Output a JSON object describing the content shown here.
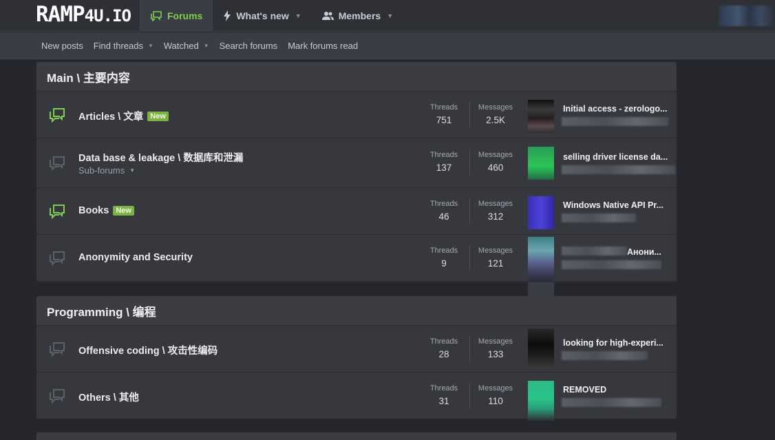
{
  "header": {
    "logo_main": "RAMP",
    "logo_suffix": "4U.IO",
    "nav": [
      {
        "label": "Forums",
        "icon": "chat-bubbles-icon",
        "active": true
      },
      {
        "label": "What's new",
        "icon": "bolt-icon",
        "has_menu": true
      },
      {
        "label": "Members",
        "icon": "users-icon",
        "has_menu": true
      }
    ]
  },
  "subnav": [
    {
      "label": "New posts"
    },
    {
      "label": "Find threads",
      "has_menu": true
    },
    {
      "label": "Watched",
      "has_menu": true
    },
    {
      "label": "Search forums"
    },
    {
      "label": "Mark forums read"
    }
  ],
  "colors": {
    "accent": "#7fcd51",
    "new_badge": "#7cb342",
    "background": "#25272c",
    "card": "#36383e"
  },
  "stat_labels": {
    "threads": "Threads",
    "messages": "Messages"
  },
  "categories": [
    {
      "title": "Main \\ 主要内容",
      "forums": [
        {
          "title": "Articles \\ 文章",
          "badge": "New",
          "unread": true,
          "threads": "751",
          "messages": "2.5K",
          "last_post_title": "Initial access - zerologo..."
        },
        {
          "title": "Data base & leakage \\ 数据库和泄漏",
          "subforums_label": "Sub-forums",
          "unread": false,
          "threads": "137",
          "messages": "460",
          "last_post_title": "selling driver license da..."
        },
        {
          "title": "Books",
          "badge": "New",
          "unread": true,
          "threads": "46",
          "messages": "312",
          "last_post_title": "Windows Native API Pr..."
        },
        {
          "title": "Anonymity and Security",
          "unread": false,
          "threads": "9",
          "messages": "121",
          "last_post_title": "Анони..."
        }
      ]
    },
    {
      "title": "Programming \\ 编程",
      "forums": [
        {
          "title": "Offensive coding \\ 攻击性编码",
          "unread": false,
          "threads": "28",
          "messages": "133",
          "last_post_title": "looking for high-experi..."
        },
        {
          "title": "Others \\ 其他",
          "unread": false,
          "threads": "31",
          "messages": "110",
          "last_post_title": "REMOVED"
        }
      ]
    }
  ]
}
